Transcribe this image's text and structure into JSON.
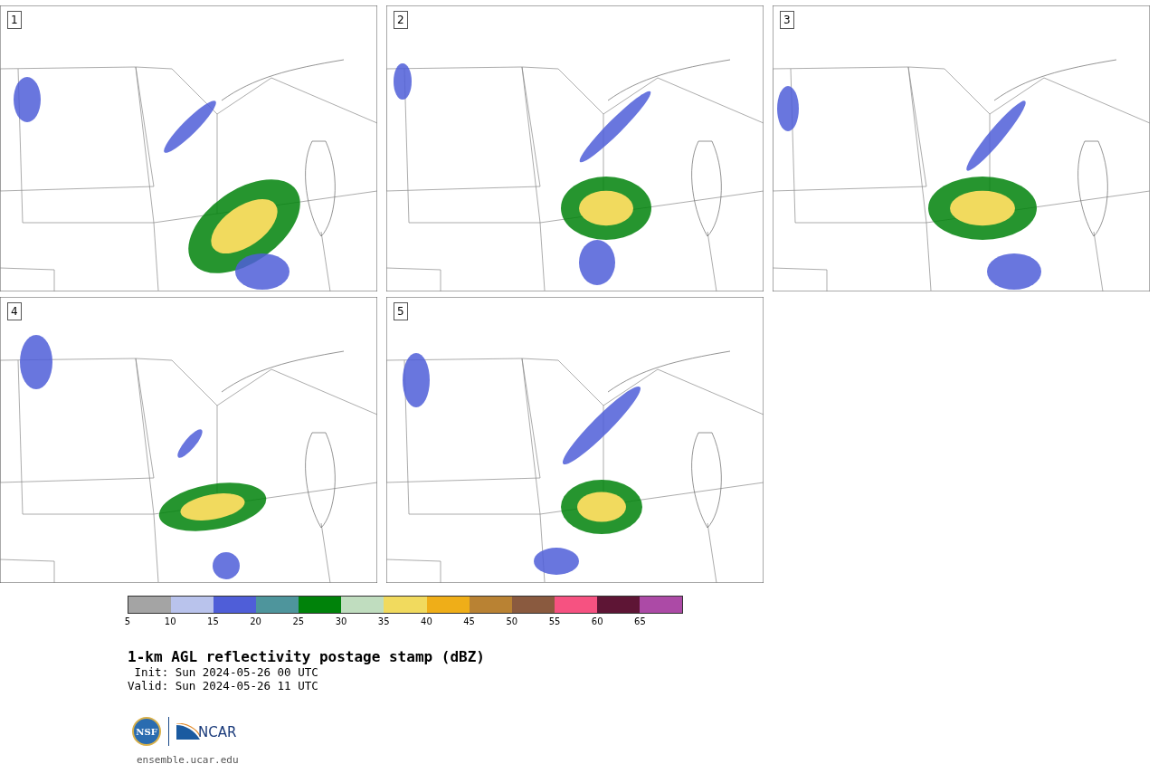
{
  "panels": [
    {
      "label": "1"
    },
    {
      "label": "2"
    },
    {
      "label": "3"
    },
    {
      "label": "4"
    },
    {
      "label": "5"
    }
  ],
  "colorbar": {
    "bins": [
      {
        "color": "#a4a4a4",
        "tick": "5"
      },
      {
        "color": "#b9c3ec",
        "tick": "10"
      },
      {
        "color": "#4f5ed8",
        "tick": "15"
      },
      {
        "color": "#4e959c",
        "tick": "20"
      },
      {
        "color": "#00820a",
        "tick": "25"
      },
      {
        "color": "#c0ddbf",
        "tick": "30"
      },
      {
        "color": "#f1da5e",
        "tick": "35"
      },
      {
        "color": "#efae18",
        "tick": "40"
      },
      {
        "color": "#b98233",
        "tick": "45"
      },
      {
        "color": "#8a5a3f",
        "tick": "50"
      },
      {
        "color": "#f65281",
        "tick": "55"
      },
      {
        "color": "#5e1535",
        "tick": "60"
      },
      {
        "color": "#ac4aa6",
        "tick": "65"
      }
    ]
  },
  "title": "1-km AGL reflectivity postage stamp (dBZ)",
  "init": " Init: Sun 2024-05-26 00 UTC",
  "valid": "Valid: Sun 2024-05-26 11 UTC",
  "logo": {
    "left": "NSF",
    "right": "NCAR"
  },
  "footer": "ensemble.ucar.edu"
}
